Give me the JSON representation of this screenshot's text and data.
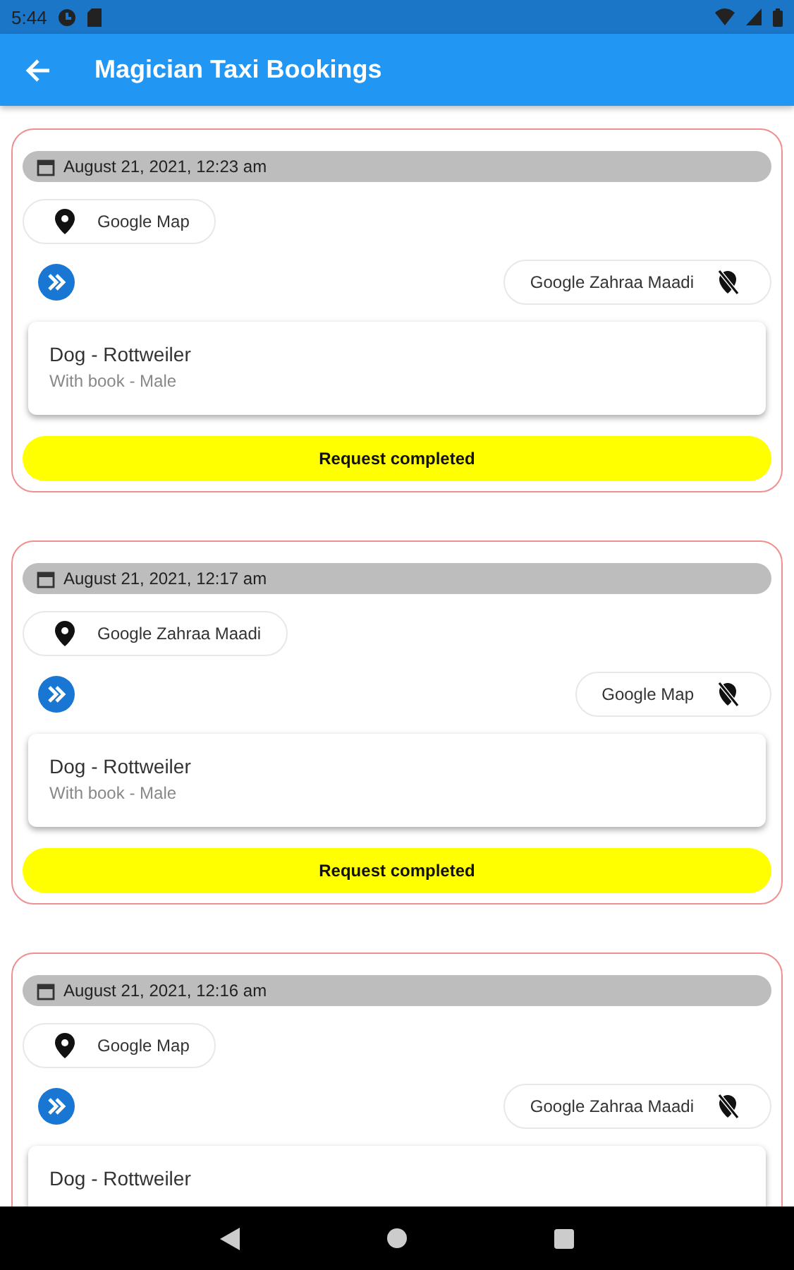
{
  "status_bar": {
    "time": "5:44"
  },
  "app_bar": {
    "title": "Magician Taxi Bookings"
  },
  "bookings": [
    {
      "date": "August 21, 2021, 12:23 am",
      "pickup": "Google Map",
      "dropoff": "Google Zahraa Maadi",
      "pet": "Dog - Rottweiler",
      "details": "With book - Male",
      "status": "Request completed"
    },
    {
      "date": "August 21, 2021, 12:17 am",
      "pickup": "Google Zahraa Maadi",
      "dropoff": "Google Map",
      "pet": "Dog - Rottweiler",
      "details": "With book - Male",
      "status": "Request completed"
    },
    {
      "date": "August 21, 2021, 12:16 am",
      "pickup": "Google Map",
      "dropoff": "Google Zahraa Maadi",
      "pet": "Dog - Rottweiler"
    }
  ]
}
